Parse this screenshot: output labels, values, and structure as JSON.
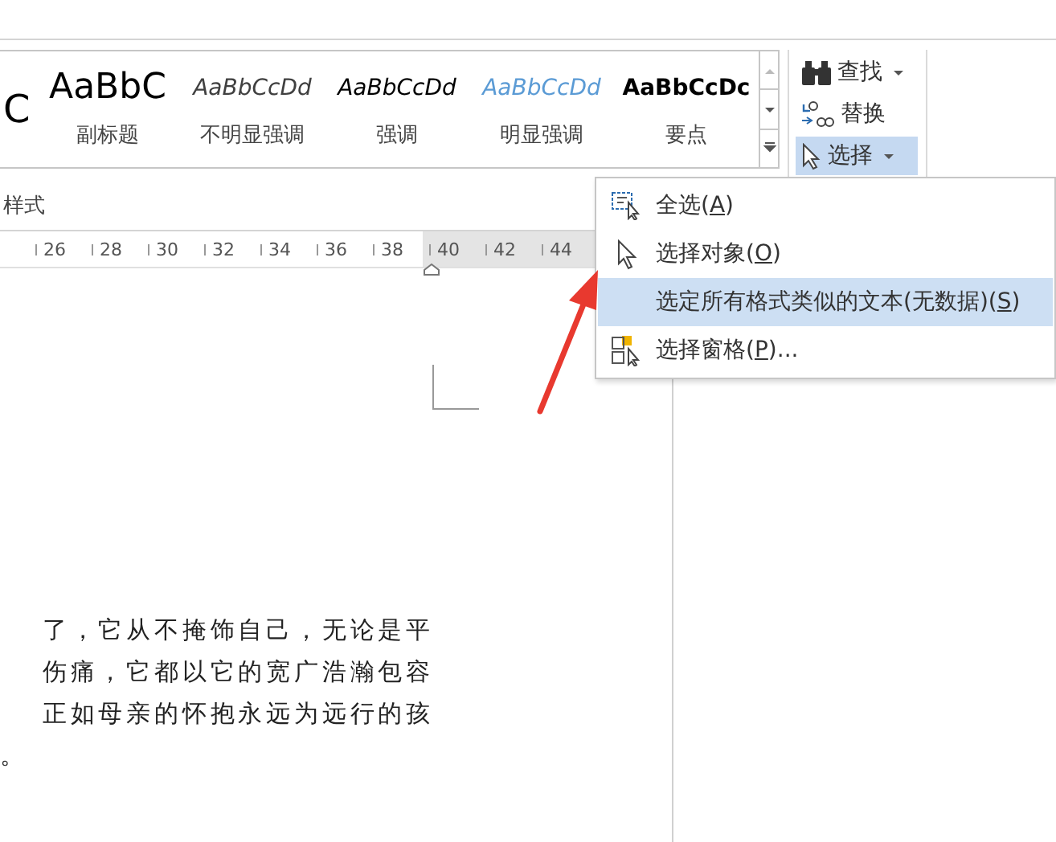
{
  "styles_gallery": {
    "items": [
      {
        "kind": "title",
        "preview": "C"
      },
      {
        "kind": "subtitle",
        "preview": "AaBbC",
        "label": "副标题"
      },
      {
        "kind": "subtle_emphasis",
        "preview": "AaBbCcDd",
        "label": "不明显强调"
      },
      {
        "kind": "emphasis",
        "preview": "AaBbCcDd",
        "label": "强调"
      },
      {
        "kind": "intense_emphasis",
        "preview": "AaBbCcDd",
        "label": "明显强调"
      },
      {
        "kind": "strong",
        "preview": "AaBbCcDc",
        "label": "要点"
      }
    ],
    "group_label": "样式"
  },
  "editing": [
    {
      "kind": "find",
      "label": "查找",
      "dropdown": true,
      "selected": false
    },
    {
      "kind": "replace",
      "label": "替换",
      "dropdown": false,
      "selected": false
    },
    {
      "kind": "select",
      "label": "选择",
      "dropdown": true,
      "selected": true
    }
  ],
  "ruler": {
    "ticks": [
      {
        "label": "26",
        "margin": false
      },
      {
        "label": "28",
        "margin": false
      },
      {
        "label": "30",
        "margin": false
      },
      {
        "label": "32",
        "margin": false
      },
      {
        "label": "34",
        "margin": false
      },
      {
        "label": "36",
        "margin": false
      },
      {
        "label": "38",
        "margin": false
      },
      {
        "label": "40",
        "margin": true
      },
      {
        "label": "42",
        "margin": true
      },
      {
        "label": "44",
        "margin": true
      }
    ]
  },
  "document": {
    "lines": [
      "了，它从不掩饰自己，无论是平",
      "伤痛，它都以它的宽广浩瀚包容",
      "正如母亲的怀抱永远为远行的孩",
      "。"
    ]
  },
  "select_menu": {
    "items": [
      {
        "kind": "select_all",
        "before": "全选(",
        "key": "A",
        "after": ")",
        "selected": false
      },
      {
        "kind": "select_objects",
        "before": "选择对象(",
        "key": "O",
        "after": ")",
        "selected": false
      },
      {
        "kind": "select_similar",
        "before": "选定所有格式类似的文本(无数据)(",
        "key": "S",
        "after": ")",
        "selected": true
      },
      {
        "kind": "selection_pane",
        "before": "选择窗格(",
        "key": "P",
        "after": ")...",
        "selected": false
      }
    ]
  }
}
